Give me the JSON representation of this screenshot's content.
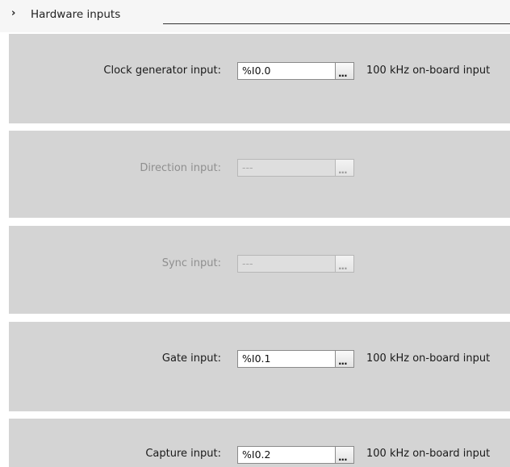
{
  "section": {
    "title": "Hardware inputs",
    "chevron_icon": "chevron-right-icon"
  },
  "inputs": [
    {
      "label": "Clock generator input:",
      "value": "%I0.0",
      "button_label": "...",
      "description": "100 kHz on-board input",
      "enabled": true
    },
    {
      "label": "Direction input:",
      "value": "---",
      "button_label": "...",
      "description": "",
      "enabled": false
    },
    {
      "label": "Sync input:",
      "value": "---",
      "button_label": "...",
      "description": "",
      "enabled": false
    },
    {
      "label": "Gate input:",
      "value": "%I0.1",
      "button_label": "...",
      "description": "100 kHz on-board input",
      "enabled": true
    },
    {
      "label": "Capture input:",
      "value": "%I0.2",
      "button_label": "...",
      "description": "100 kHz on-board input",
      "enabled": true
    }
  ]
}
